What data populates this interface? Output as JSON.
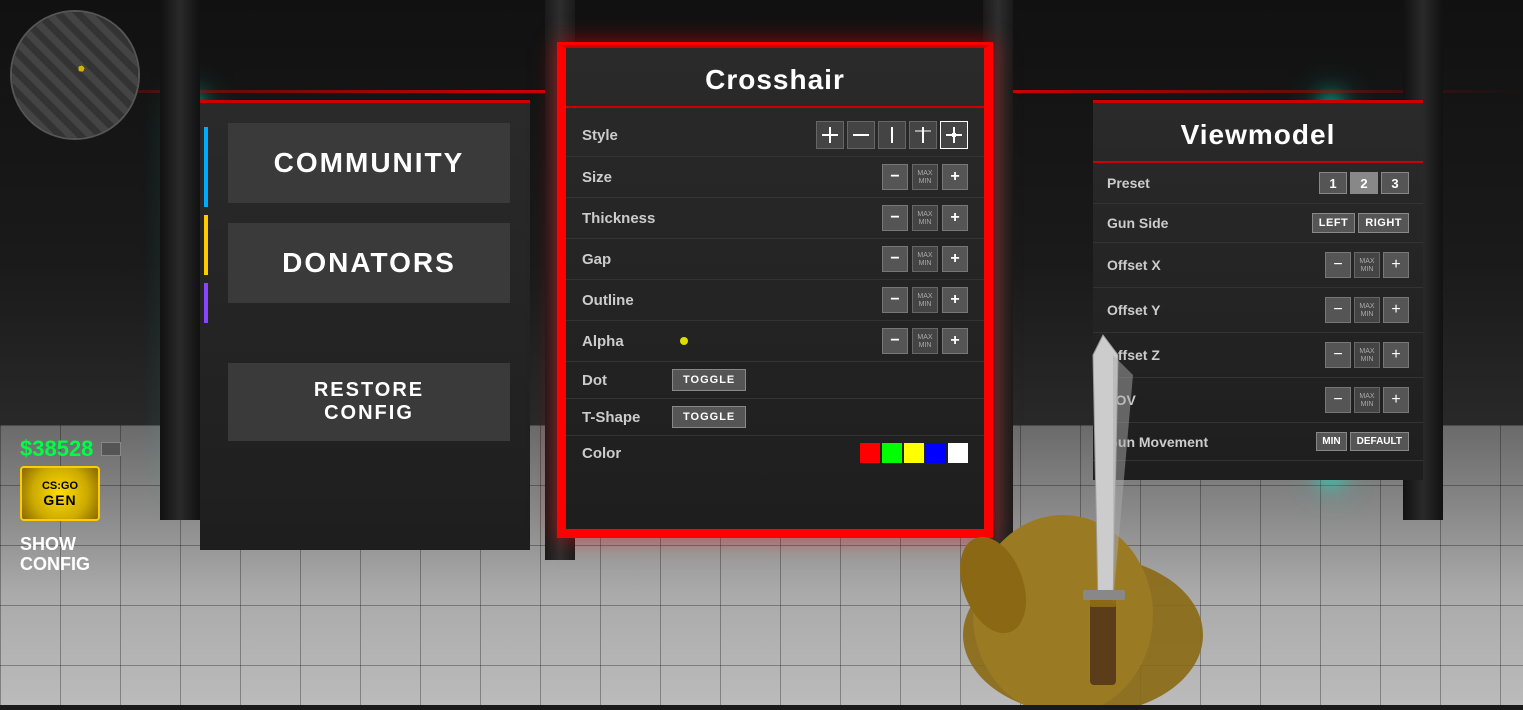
{
  "scene": {
    "bg_color": "#0d1f1f"
  },
  "hud": {
    "money": "$38528",
    "badge_line1": "CS:GO",
    "badge_line2": "GEN",
    "show_config": "SHOW\nCONFIG"
  },
  "left_panel": {
    "community_label": "COMMUNITY",
    "donators_label": "DONATORS",
    "restore_line1": "RESTORE",
    "restore_line2": "CONFIG"
  },
  "crosshair_panel": {
    "title": "Crosshair",
    "rows": [
      {
        "label": "Style",
        "control_type": "presets"
      },
      {
        "label": "Size",
        "control_type": "stepper"
      },
      {
        "label": "Thickness",
        "control_type": "stepper"
      },
      {
        "label": "Gap",
        "control_type": "stepper"
      },
      {
        "label": "Outline",
        "control_type": "stepper"
      },
      {
        "label": "Alpha",
        "control_type": "stepper_dot"
      },
      {
        "label": "Dot",
        "control_type": "toggle"
      },
      {
        "label": "T-Shape",
        "control_type": "toggle"
      },
      {
        "label": "Color",
        "control_type": "color"
      }
    ],
    "toggle_label": "TOGGLE",
    "max_label": "MAX",
    "min_label": "MIN",
    "color_swatches": [
      "#ff0000",
      "#00ff00",
      "#0000ff",
      "#ffff00",
      "#ff00ff",
      "#ffffff"
    ]
  },
  "viewmodel_panel": {
    "title": "Viewmodel",
    "rows": [
      {
        "label": "Preset",
        "control_type": "presets_123"
      },
      {
        "label": "Gun Side",
        "control_type": "lr"
      },
      {
        "label": "Offset X",
        "control_type": "stepper"
      },
      {
        "label": "Offset Y",
        "control_type": "stepper"
      },
      {
        "label": "Offset Z",
        "control_type": "stepper"
      },
      {
        "label": "FOV",
        "control_type": "stepper"
      },
      {
        "label": "Gun Movement",
        "control_type": "min_default"
      }
    ],
    "preset_labels": [
      "1",
      "2",
      "3"
    ],
    "left_label": "LEFT",
    "right_label": "RIGHT",
    "max_label": "MAX",
    "min_label": "MIN",
    "min_btn_label": "MIN",
    "default_btn_label": "DEFAULT"
  }
}
